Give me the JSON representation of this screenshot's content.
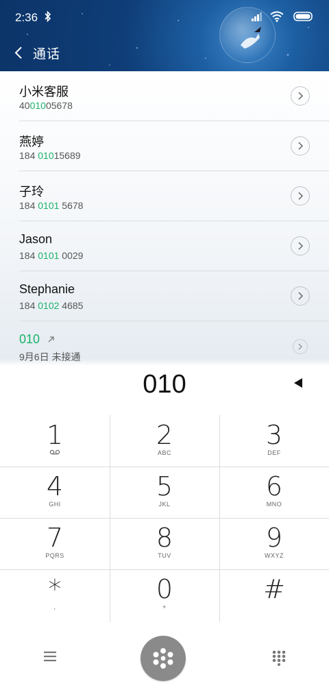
{
  "status": {
    "time": "2:36"
  },
  "header": {
    "title": "通话"
  },
  "contacts": [
    {
      "name": "小米客服",
      "num_pre": "40",
      "num_hl": "010",
      "num_post": "05678"
    },
    {
      "name": "燕婷",
      "num_pre": "184 ",
      "num_hl": "010",
      "num_post": "15689"
    },
    {
      "name": "子玲",
      "num_pre": "184 ",
      "num_hl": "0101",
      "num_post": " 5678"
    },
    {
      "name": "Jason",
      "num_pre": "184 ",
      "num_hl": "0101",
      "num_post": " 0029"
    },
    {
      "name": "Stephanie",
      "num_pre": "184 ",
      "num_hl": "0102",
      "num_post": " 4685"
    }
  ],
  "recent": {
    "number": "010",
    "detail": "9月6日 未接通"
  },
  "display": {
    "digits": "010"
  },
  "keys": [
    {
      "digit": "1",
      "letters": ""
    },
    {
      "digit": "2",
      "letters": "ABC"
    },
    {
      "digit": "3",
      "letters": "DEF"
    },
    {
      "digit": "4",
      "letters": "GHI"
    },
    {
      "digit": "5",
      "letters": "JKL"
    },
    {
      "digit": "6",
      "letters": "MNO"
    },
    {
      "digit": "7",
      "letters": "PQRS"
    },
    {
      "digit": "8",
      "letters": "TUV"
    },
    {
      "digit": "9",
      "letters": "WXYZ"
    },
    {
      "digit": "*",
      "letters": ","
    },
    {
      "digit": "0",
      "letters": "+"
    },
    {
      "digit": "#",
      "letters": ""
    }
  ],
  "colors": {
    "accent": "#1bb36b",
    "header_bg": "#1d5fa3",
    "call_button": "#8a8a8a"
  },
  "icons": {
    "bottom_left": "menu-icon",
    "bottom_center": "dialpad-call-icon",
    "bottom_right": "keypad-grid-icon"
  }
}
